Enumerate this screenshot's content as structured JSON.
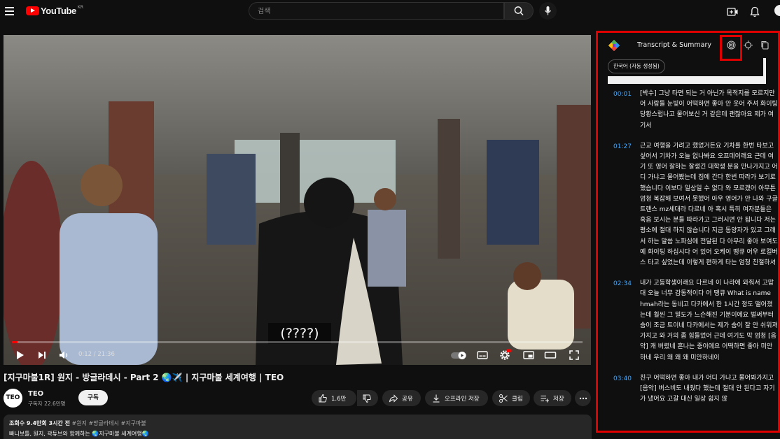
{
  "topbar": {
    "logo_text": "YouTube",
    "region": "KR",
    "search_placeholder": "검색"
  },
  "player": {
    "subtitle": "(????)",
    "time": "0:12 / 21:36",
    "progress_fraction": 0.0093
  },
  "video": {
    "title": "[지구마불1R] 원지 - 방글라데시 - Part 2 🌏✈️  | 지구마불 세계여행 | TEO",
    "channel": {
      "avatar_text": "TEO",
      "name": "TEO",
      "subscribers": "구독자 22.6만명",
      "subscribe_label": "구독"
    },
    "actions": {
      "likes": "1.6만",
      "share": "공유",
      "offline": "오프라인 저장",
      "clip": "클립",
      "save": "저장"
    },
    "description": {
      "meta": "조회수 9.4만회  3시간 전",
      "tags": "#원지 #방글라데시 #지구마불",
      "line2": "빠니보틀, 원지, 곽튜브와 함께하는 🌏지구마불 세계여행🌏"
    }
  },
  "panel": {
    "title": "Transcript & Summary",
    "language_chip": "한국어 (자동 생성됨)",
    "entries": [
      {
        "time": "00:01",
        "text": "[박수] 그냥 타면 되는 거 아닌가 목적지를 모르지만 어 사람들 눈빛이 어떡하면 좋아 안 웃어 주셔 화이팅 당황스럽나고 물어보신 거 같은데 괜찮아요 제가 여기서"
      },
      {
        "time": "01:27",
        "text": "근교 여행을 가려고 했었거든요 기차를 한번 타보고 싶어서 기차가 오늘 없나봐요 오프데이래요 근데 여기 또 영어 잘하는 잘생긴 대학생 분을 만나가지고 어디 가냐고 물어봤는데 집에 간다 한번 따라가 보기로 했습니다 이보다 일상일 수 없다 와 모르겠어 아무튼 엄청 복잡해 보여서 못했어 아우 영어가 안 나와 구글 트랜스 mz세대라 다르네 아 혹시 특히 여자분들은 혹음 보시는 분들 따라가고 그러시면 안 됩니다 저는 평소에 절대 하지 않습니다 지금 동양자가 있고 그래서 하는 말씀 노파심에 전달된 다 아무리 좋아 보여도 예 화이팅 하십시다 어 있어 오케이 땡큐 어우 로컬버스 타고 싶었는데 이렇게 편하게 타는 엄청 친절하셔"
      },
      {
        "time": "02:34",
        "text": "내가 고등학생이래요 다르네 이 나라에 와줘서 고맙대 오늘 너무 감동적이다 어 땡큐 What is name hmah라는 동네고 다카에서 한 1시간 정도 떨어졌는데 훨씬 그 밀도가 느슨해진 기분이에요 벌써부터 숨이 조금 트이네 다카에서는 제가 숨이 잘 안 쉬워져가지고 와 거의 좀 힘들었어 근데 여기도 막 엄청 [음악] 캐 버렸네 흔나는 중이에요 어떡하면 좋아 미안하네 우리 왜 왜 왜 미안하네이"
      },
      {
        "time": "03:40",
        "text": "친구 어떡하면 좋아 내가 어디 가냐고 물어봐가지고 [음악] 버스비도 내줬다 했는데 절대 안 된다고 자기가 냈어요 고갈 대신 일상 쉽지 않"
      }
    ]
  },
  "colors": {
    "accent": "#ff0000",
    "highlight_border": "#e00000",
    "timestamp": "#3ea6ff",
    "background": "#0f0f0f"
  }
}
